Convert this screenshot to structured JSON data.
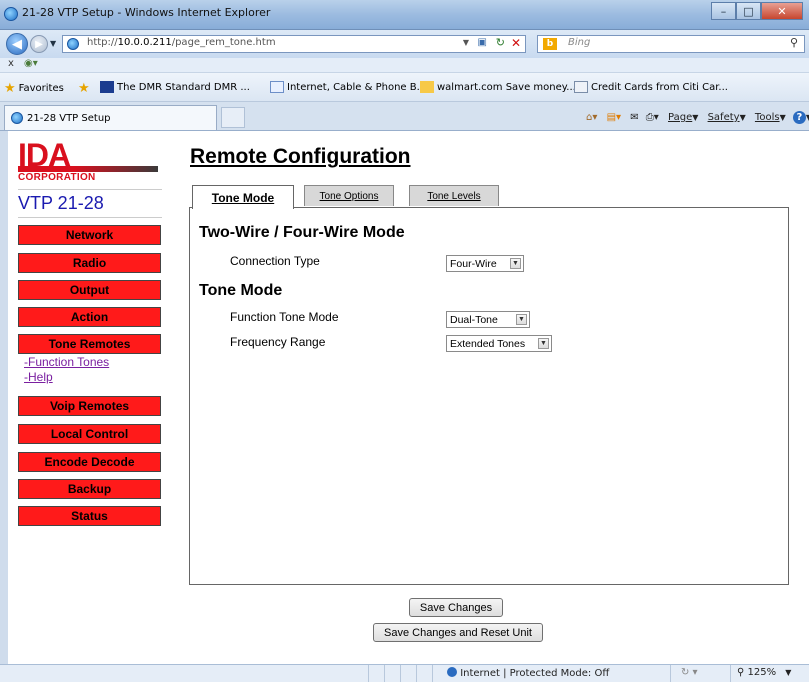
{
  "window": {
    "title": "21-28 VTP Setup - Windows Internet Explorer"
  },
  "address": {
    "url_prefix": "http://",
    "url_host": "10.0.0.211",
    "url_path": "/page_rem_tone.htm",
    "search_engine": "Bing"
  },
  "toolbar2": {
    "label": "x"
  },
  "favorites": {
    "label": "Favorites",
    "items": [
      "The DMR Standard  DMR ...",
      "Internet, Cable & Phone B...",
      "walmart.com Save money....",
      "Credit Cards from Citi Car..."
    ]
  },
  "tab": {
    "label": "21-28 VTP Setup"
  },
  "commandbar": {
    "page": "Page",
    "safety": "Safety",
    "tools": "Tools"
  },
  "logo": {
    "text": "IDA",
    "corp": "CORPORATION"
  },
  "device": {
    "model": "VTP 21-28"
  },
  "nav": {
    "items": [
      "Network",
      "Radio",
      "Output",
      "Action",
      "Tone Remotes",
      "Voip Remotes",
      "Local Control",
      "Encode Decode",
      "Backup",
      "Status"
    ],
    "sublinks": [
      "-Function Tones",
      "-Help"
    ]
  },
  "page": {
    "heading": "Remote Configuration"
  },
  "tabs": [
    "Tone Mode",
    "Tone Options",
    "Tone Levels"
  ],
  "form": {
    "section1": "Two-Wire / Four-Wire Mode",
    "connection_type_label": "Connection Type",
    "connection_type_value": "Four-Wire",
    "section2": "Tone Mode",
    "function_tone_mode_label": "Function Tone Mode",
    "function_tone_mode_value": "Dual-Tone",
    "frequency_range_label": "Frequency Range",
    "frequency_range_value": "Extended Tones"
  },
  "buttons": {
    "save": "Save Changes",
    "save_reset": "Save Changes and Reset Unit"
  },
  "status": {
    "zone": "Internet | Protected Mode: Off",
    "zoom": "125%"
  },
  "colors": {
    "nav_red": "#ff1a1a",
    "logo_red": "#d9101e",
    "model_blue": "#1a1ab0",
    "link_purple": "#7a1fa0"
  }
}
